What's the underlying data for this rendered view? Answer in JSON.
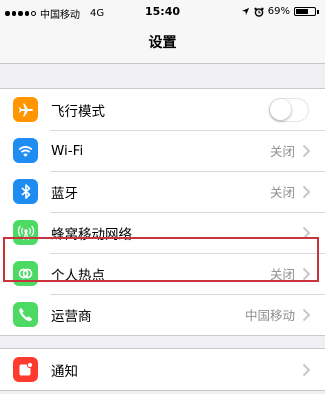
{
  "status_bar": {
    "carrier": "中国移动",
    "network": "4G",
    "time": "15:40",
    "battery": "69%",
    "battery_level": 0.69
  },
  "nav": {
    "title": "设置"
  },
  "groups": [
    {
      "rows": [
        {
          "label": "飞行模式",
          "icon": "airplane-icon",
          "color": "#ff9500",
          "toggle": false
        },
        {
          "label": "Wi-Fi",
          "value": "关闭",
          "icon": "wifi-icon",
          "color": "#1e8cf0"
        },
        {
          "label": "蓝牙",
          "value": "关闭",
          "icon": "bluetooth-icon",
          "color": "#1e8cf0"
        },
        {
          "label": "蜂窝移动网络",
          "icon": "cellular-antenna-icon",
          "color": "#4cd964"
        },
        {
          "label": "个人热点",
          "value": "关闭",
          "icon": "personal-hotspot-icon",
          "color": "#4cd964"
        },
        {
          "label": "运营商",
          "value": "中国移动",
          "icon": "phone-icon",
          "color": "#4cd964"
        }
      ]
    },
    {
      "rows": [
        {
          "label": "通知",
          "icon": "notifications-icon",
          "color": "#ff3b30"
        }
      ]
    }
  ],
  "highlight_color": "#c9333c"
}
